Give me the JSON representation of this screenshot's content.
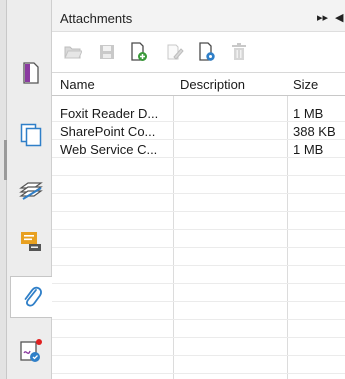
{
  "panel": {
    "title": "Attachments",
    "header_controls": [
      "▸▸",
      "◀"
    ]
  },
  "sidebar": {
    "items": [
      {
        "icon": "pages-icon"
      },
      {
        "icon": "layers-icon"
      },
      {
        "icon": "stacked-layers-icon"
      },
      {
        "icon": "comments-icon"
      },
      {
        "icon": "attachments-paperclip-icon",
        "active": true
      },
      {
        "icon": "signature-icon"
      }
    ]
  },
  "toolbar": {
    "buttons": [
      {
        "icon": "open-folder-icon",
        "enabled": false
      },
      {
        "icon": "save-icon",
        "enabled": false
      },
      {
        "icon": "add-file-icon",
        "enabled": true
      },
      {
        "icon": "edit-description-icon",
        "enabled": false
      },
      {
        "icon": "file-settings-icon",
        "enabled": true
      },
      {
        "icon": "delete-icon",
        "enabled": false
      }
    ]
  },
  "table": {
    "columns": [
      "Name",
      "Description",
      "Size"
    ],
    "rows": [
      {
        "name": "Foxit Reader D...",
        "description": "",
        "size": "1 MB"
      },
      {
        "name": "SharePoint Co...",
        "description": "",
        "size": "388 KB"
      },
      {
        "name": "Web Service C...",
        "description": "",
        "size": "1 MB"
      }
    ]
  },
  "colors": {
    "accent_blue": "#2f7fc8",
    "accent_green": "#3a9a3a",
    "comment_orange": "#e8a020",
    "notification_red": "#e02020"
  }
}
